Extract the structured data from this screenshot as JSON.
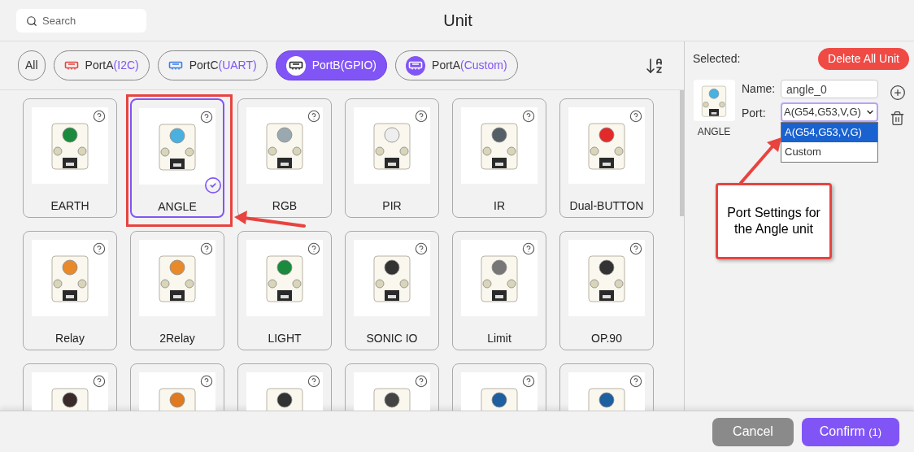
{
  "dialog": {
    "title": "Unit"
  },
  "search": {
    "placeholder": "Search"
  },
  "filters": [
    {
      "label": "All",
      "selected": false
    },
    {
      "label": "PortA",
      "detail": "(I2C)",
      "kind": "plain",
      "color": "#e8433f",
      "selected": false
    },
    {
      "label": "PortC",
      "detail": "(UART)",
      "kind": "plain",
      "color": "#3a7ee8",
      "selected": false
    },
    {
      "label": "PortB",
      "detail": "(GPIO)",
      "kind": "badge",
      "color": "#222222",
      "selected": true
    },
    {
      "label": "PortA",
      "detail": "(Custom)",
      "kind": "badge",
      "color": "#8155f5",
      "selected": false
    }
  ],
  "cards": [
    {
      "name": "EARTH",
      "selected": false
    },
    {
      "name": "ANGLE",
      "selected": true
    },
    {
      "name": "RGB",
      "selected": false
    },
    {
      "name": "PIR",
      "selected": false
    },
    {
      "name": "IR",
      "selected": false
    },
    {
      "name": "Dual-BUTTON",
      "selected": false
    },
    {
      "name": "Relay",
      "selected": false
    },
    {
      "name": "2Relay",
      "selected": false
    },
    {
      "name": "LIGHT",
      "selected": false
    },
    {
      "name": "SONIC IO",
      "selected": false
    },
    {
      "name": "Limit",
      "selected": false
    },
    {
      "name": "OP.90",
      "selected": false
    },
    {
      "selected": false
    },
    {
      "selected": false
    },
    {
      "selected": false
    },
    {
      "selected": false
    },
    {
      "selected": false
    },
    {
      "selected": false
    }
  ],
  "selected_panel": {
    "heading": "Selected:",
    "delete_all": "Delete All Unit",
    "unit": {
      "caption": "ANGLE",
      "name_label": "Name:",
      "name_value": "angle_0",
      "port_label": "Port:",
      "port_value": "A(G54,G53,V,G)",
      "port_options": [
        {
          "label": "A(G54,G53,V,G)",
          "selected": true
        },
        {
          "label": "Custom",
          "selected": false
        }
      ]
    }
  },
  "annotation": {
    "text": "Port Settings for the Angle unit"
  },
  "footer": {
    "cancel": "Cancel",
    "confirm": "Confirm",
    "confirm_count": "(1)"
  }
}
